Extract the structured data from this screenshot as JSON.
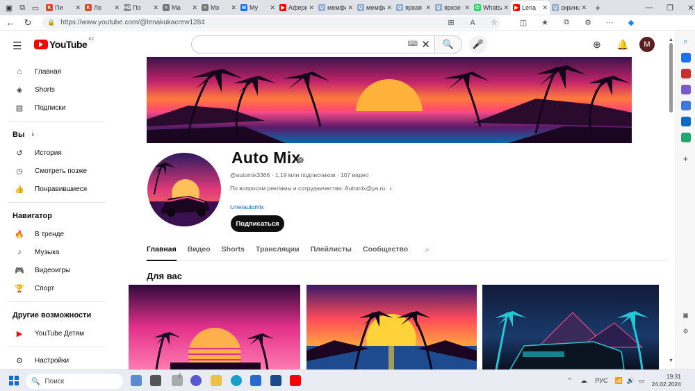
{
  "browser": {
    "tabs": [
      {
        "label": "Пи",
        "color": "#d54a24",
        "glyph": "K"
      },
      {
        "label": "Ло",
        "color": "#d54a24",
        "glyph": "K"
      },
      {
        "label": "По",
        "color": "#888888",
        "glyph": "HD"
      },
      {
        "label": "Ма",
        "color": "#777777",
        "glyph": "≈"
      },
      {
        "label": "Мэ",
        "color": "#777777",
        "glyph": "≈"
      },
      {
        "label": "Му",
        "color": "#1a73e8",
        "glyph": "M"
      },
      {
        "label": "Афери",
        "color": "#ff0000",
        "glyph": "▶"
      },
      {
        "label": "мемфи",
        "color": "#8fa8d0",
        "glyph": "Q"
      },
      {
        "label": "мемфи",
        "color": "#8fa8d0",
        "glyph": "Q"
      },
      {
        "label": "яркая к",
        "color": "#8fa8d0",
        "glyph": "Q"
      },
      {
        "label": "яркое с",
        "color": "#8fa8d0",
        "glyph": "Q"
      },
      {
        "label": "WhatsA",
        "color": "#25d366",
        "glyph": "✆"
      },
      {
        "label": "Lena",
        "color": "#ff0000",
        "glyph": "▶"
      },
      {
        "label": "скриншо",
        "color": "#8fa8d0",
        "glyph": "Q"
      }
    ],
    "url": "https://www.youtube.com/@lenakukacrew1284"
  },
  "youtube": {
    "logo_text": "YouTube",
    "region": "KZ",
    "avatar_letter": "M",
    "sidebar": {
      "main": [
        {
          "label": "Главная",
          "icon": "home-icon",
          "glyph": "⌂"
        },
        {
          "label": "Shorts",
          "icon": "shorts-icon",
          "glyph": "◈"
        },
        {
          "label": "Подписки",
          "icon": "subscriptions-icon",
          "glyph": "▤"
        }
      ],
      "you_title": "Вы",
      "you": [
        {
          "label": "История",
          "icon": "history-icon",
          "glyph": "↺"
        },
        {
          "label": "Смотреть позже",
          "icon": "clock-icon",
          "glyph": "◷"
        },
        {
          "label": "Понравившиеся",
          "icon": "like-icon",
          "glyph": "👍"
        }
      ],
      "nav_title": "Навигатор",
      "nav": [
        {
          "label": "В тренде",
          "icon": "trending-icon",
          "glyph": "🔥"
        },
        {
          "label": "Музыка",
          "icon": "music-icon",
          "glyph": "♪"
        },
        {
          "label": "Видеоигры",
          "icon": "gaming-icon",
          "glyph": "🎮"
        },
        {
          "label": "Спорт",
          "icon": "sport-icon",
          "glyph": "🏆"
        }
      ],
      "more_title": "Другие возможности",
      "more": [
        {
          "label": "YouTube Детям",
          "icon": "youtube-kids-icon",
          "glyph": "▶"
        }
      ],
      "settings": {
        "label": "Настройки",
        "icon": "settings-icon",
        "glyph": "⚙"
      }
    },
    "channel": {
      "name": "Auto Mix",
      "handle": "@automix3366",
      "subscribers": "1,19 млн подписчиков",
      "videos": "107 видео",
      "description": "По вопросам рекламы и сотрудничества: Automix@ya.ru",
      "link": "t.me/automix",
      "subscribe_label": "Подписаться",
      "tabs": [
        "Главная",
        "Видео",
        "Shorts",
        "Трансляции",
        "Плейлисты",
        "Сообщество"
      ],
      "section_title": "Для вас"
    }
  },
  "taskbar": {
    "search_label": "Поиск",
    "language": "РУС",
    "time": "19:31",
    "date": "24.02.2024",
    "notification": "7"
  }
}
